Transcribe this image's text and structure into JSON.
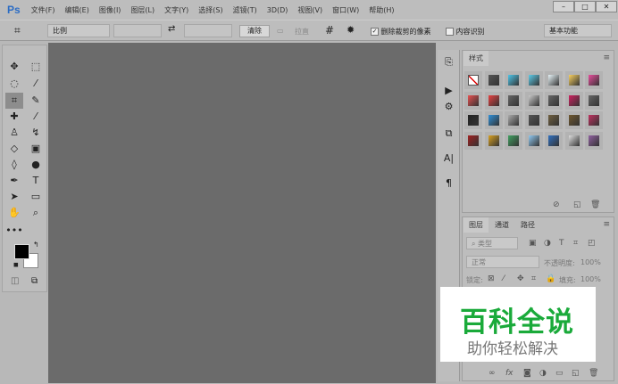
{
  "app": {
    "logo": "Ps",
    "menu": [
      "文件(F)",
      "编辑(E)",
      "图像(I)",
      "图层(L)",
      "文字(Y)",
      "选择(S)",
      "滤镜(T)",
      "3D(D)",
      "视图(V)",
      "窗口(W)",
      "帮助(H)"
    ],
    "window_buttons": [
      "–",
      "□",
      "✕"
    ]
  },
  "options": {
    "ratio": "比例",
    "clear": "清除",
    "straighten": "拉直",
    "delete_cropped": "删除裁剪的像素",
    "delete_cropped_checked": true,
    "content_aware": "内容识别",
    "content_aware_checked": false,
    "workspace": "基本功能"
  },
  "styles_panel": {
    "tab": "样式",
    "swatch_colors": [
      [
        "#fff",
        "#555",
        "#4cc4e8",
        "#5ccbe8",
        "#e8f4f8",
        "#f8d060",
        "#e84c9c"
      ],
      [
        "#e85050",
        "#e84040",
        "#666",
        "#c8c8c8",
        "#666",
        "#d02060",
        "#666"
      ],
      [
        "#222",
        "#3090d8",
        "#aaa",
        "#555",
        "#706040",
        "#705830",
        "#c03060"
      ],
      [
        "#a02020",
        "#d8a020",
        "#40a060",
        "#90c8f0",
        "#3070c0",
        "#ddd",
        "#9060a0"
      ]
    ]
  },
  "layers_panel": {
    "tabs": [
      "图层",
      "通道",
      "路径"
    ],
    "filter": "类型",
    "blend": "正常",
    "opacity_label": "不透明度:",
    "opacity": "100%",
    "lock_label": "锁定:",
    "fill_label": "填充:",
    "fill": "100%"
  },
  "watermark": {
    "title": "百科全说",
    "subtitle": "助你轻松解决"
  },
  "colors": {
    "foreground": "#000000",
    "background": "#ffffff",
    "watermark_green": "#1aaa3a"
  }
}
